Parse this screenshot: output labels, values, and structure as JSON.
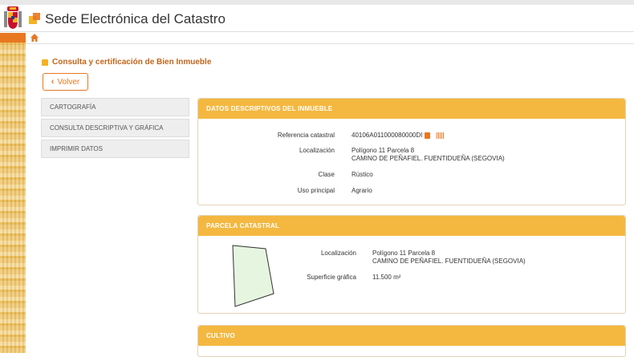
{
  "header": {
    "title": "Sede Electrónica del Catastro"
  },
  "page": {
    "heading": "Consulta y certificación de Bien Inmueble",
    "back_label": "Volver"
  },
  "menu": {
    "items": [
      {
        "label": "CARTOGRAFÍA"
      },
      {
        "label": "CONSULTA DESCRIPTIVA Y GRÁFICA"
      },
      {
        "label": "IMPRIMIR DATOS"
      }
    ]
  },
  "datos": {
    "title": "DATOS DESCRIPTIVOS DEL INMUEBLE",
    "ref_label": "Referencia catastral",
    "ref_value": "40106A011000080000DI",
    "loc_label": "Localización",
    "loc_line1": "Polígono 11 Parcela 8",
    "loc_line2": "CAMINO DE PEÑAFIEL. FUENTIDUEÑA (SEGOVIA)",
    "clase_label": "Clase",
    "clase_value": "Rústico",
    "uso_label": "Uso principal",
    "uso_value": "Agrario"
  },
  "parcela": {
    "title": "PARCELA CATASTRAL",
    "loc_label": "Localización",
    "loc_line1": "Polígono 11 Parcela 8",
    "loc_line2": "CAMINO DE PEÑAFIEL. FUENTIDUEÑA (SEGOVIA)",
    "sup_label": "Superficie gráfica",
    "sup_value": "11.500 m²"
  },
  "cultivo": {
    "title": "CULTIVO"
  },
  "colors": {
    "accent": "#f4b840",
    "brand_orange": "#e87722",
    "heading": "#c0651b"
  },
  "icons": [
    "coat-of-arms-icon",
    "catastro-logo-icon",
    "home-icon",
    "chevron-left-icon",
    "copy-icon",
    "barcode-icon"
  ]
}
